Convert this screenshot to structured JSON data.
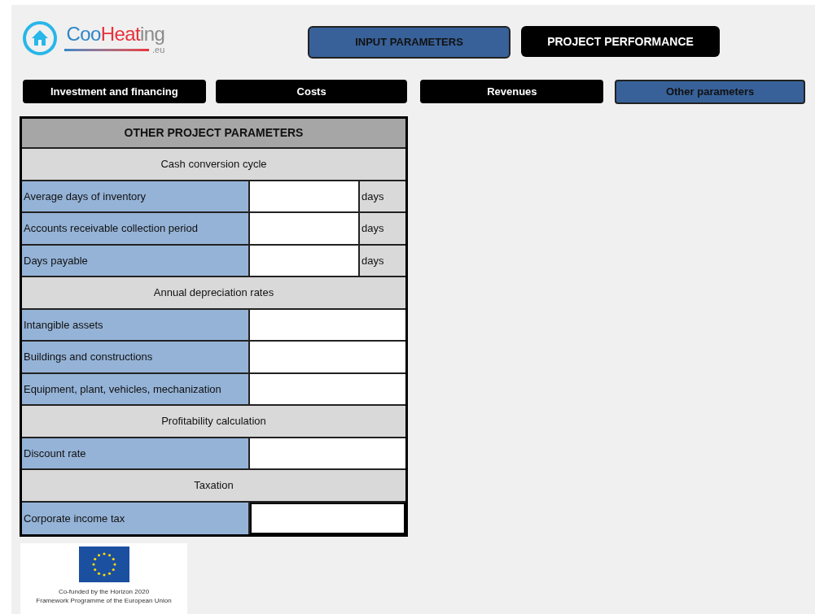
{
  "logo": {
    "parts": [
      {
        "text": "Coo",
        "color": "#2e86c8"
      },
      {
        "text": "Heat",
        "color": "#e8303a"
      },
      {
        "text": "ing",
        "color": "#8a8a8a"
      }
    ],
    "domain": ".eu"
  },
  "nav_buttons": [
    {
      "label": "INPUT PARAMETERS",
      "selected": true
    },
    {
      "label": "PROJECT PERFORMANCE",
      "selected": false
    }
  ],
  "tabs": [
    {
      "label": "Investment and financing",
      "selected": false
    },
    {
      "label": "Costs",
      "selected": false
    },
    {
      "label": "Revenues",
      "selected": false
    },
    {
      "label": "Other parameters",
      "selected": true
    }
  ],
  "table": {
    "title": "OTHER PROJECT PARAMETERS",
    "rows": [
      {
        "kind": "section",
        "label": "Cash conversion cycle"
      },
      {
        "kind": "input",
        "label": "Average days of inventory",
        "unit": "days",
        "selected": false
      },
      {
        "kind": "input",
        "label": "Accounts receivable collection period",
        "unit": "days",
        "selected": false
      },
      {
        "kind": "input",
        "label": "Days payable",
        "unit": "days",
        "selected": false
      },
      {
        "kind": "section",
        "label": "Annual depreciation rates"
      },
      {
        "kind": "input",
        "label": "Intangible assets",
        "selected": false
      },
      {
        "kind": "input",
        "label": "Buildings and constructions",
        "selected": false
      },
      {
        "kind": "input",
        "label": "Equipment, plant, vehicles, mechanization",
        "selected": false
      },
      {
        "kind": "section",
        "label": "Profitability calculation"
      },
      {
        "kind": "input",
        "label": "Discount rate",
        "selected": false
      },
      {
        "kind": "section",
        "label": "Taxation"
      },
      {
        "kind": "input",
        "label": "Corporate income tax",
        "selected": true
      }
    ]
  },
  "eu_notice": {
    "lines": [
      "Co-funded by the Horizon 2020",
      "Framework Programme of the European Union"
    ]
  }
}
